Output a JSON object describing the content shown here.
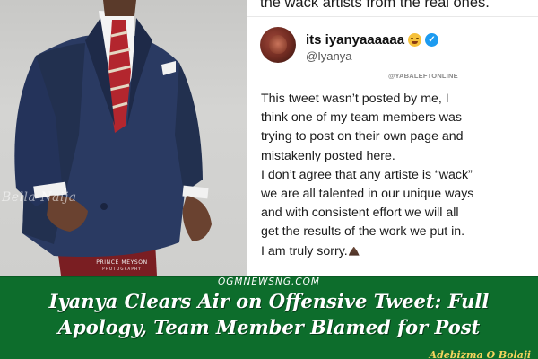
{
  "photo": {
    "watermark": "Bella Naija",
    "credit_name": "PRINCE MEYSON",
    "credit_sub": "PHOTOGRAPHY"
  },
  "tweet": {
    "previous_line": "the wack artists from the real ones.",
    "display_name": "its iyanyaaaaaa",
    "handle": "@Iyanya",
    "source_tag": "@YABALEFTONLINE",
    "lines": [
      "This tweet wasn’t posted by me,  I",
      "think one of my team members was",
      "trying to post on their own page and",
      "mistakenly posted here.",
      "I don’t agree that any artiste is “wack”",
      "we are all talented in our unique ways",
      "and with consistent effort we will all",
      "get the results of the work we put in.",
      "I am truly sorry."
    ],
    "icons": {
      "emoji": "grinning-face-icon",
      "verified": "verified-badge-icon",
      "closing_emoji": "praying-hands-icon"
    }
  },
  "banner": {
    "site": "OGMNEWSNG.COM",
    "headline_line1": "Iyanya Clears Air on Offensive Tweet: Full",
    "headline_line2": "Apology, Team Member Blamed for Post",
    "author": "Adebizma O Bolaji",
    "colors": {
      "background": "#0d6d2c",
      "author": "#f4d35e"
    }
  }
}
